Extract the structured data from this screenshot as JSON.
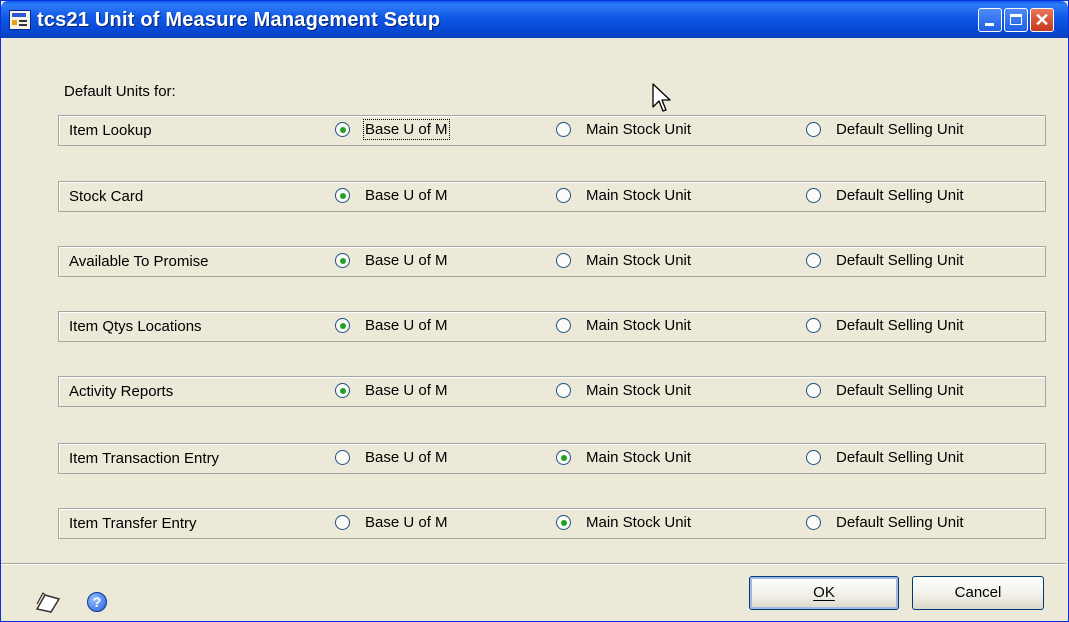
{
  "window": {
    "title": "tcs21 Unit of Measure Management Setup",
    "icon": "form-icon",
    "controls": [
      "minimize-icon",
      "maximize-icon",
      "close-icon"
    ]
  },
  "section_label": "Default Units for:",
  "option_labels": [
    "Base U of M",
    "Main Stock Unit",
    "Default Selling Unit"
  ],
  "rows": [
    {
      "label": "Item Lookup",
      "selected": "Base U of M"
    },
    {
      "label": "Stock Card",
      "selected": "Base U of M"
    },
    {
      "label": "Available To Promise",
      "selected": "Base U of M"
    },
    {
      "label": "Item Qtys Locations",
      "selected": "Base U of M"
    },
    {
      "label": "Activity Reports",
      "selected": "Base U of M"
    },
    {
      "label": "Item Transaction Entry",
      "selected": "Main Stock Unit"
    },
    {
      "label": "Item Transfer Entry",
      "selected": "Main Stock Unit"
    }
  ],
  "footer": {
    "ok_label": "OK",
    "cancel_label": "Cancel",
    "icons": [
      "note-icon",
      "help-icon"
    ]
  },
  "colors": {
    "titlebar": "#0a5bf3",
    "dialog_bg": "#ece9d8",
    "radio_checked": "#21a121",
    "close_button": "#c4381b"
  }
}
